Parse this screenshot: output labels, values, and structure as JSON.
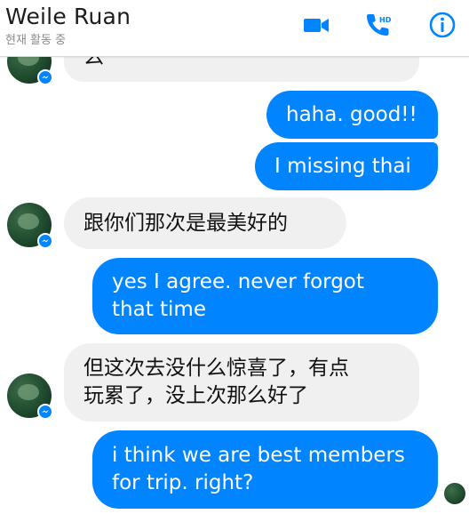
{
  "header": {
    "contact_name": "Weile Ruan",
    "status": "현재 활동 중",
    "icons": [
      "video-call-icon",
      "hd-voice-call-icon",
      "info-icon"
    ],
    "accent_color": "#0084ff"
  },
  "messages": [
    {
      "direction": "incoming",
      "text": "么"
    },
    {
      "direction": "outgoing",
      "text": "haha. good!!"
    },
    {
      "direction": "outgoing",
      "text": "I missing thai"
    },
    {
      "direction": "incoming",
      "text": "跟你们那次是最美好的"
    },
    {
      "direction": "outgoing",
      "lines": [
        "yes  I agree. never forgot",
        "that time"
      ]
    },
    {
      "direction": "incoming",
      "lines": [
        "但这次去没什么惊喜了，有点",
        "玩累了，没上次那么好了"
      ]
    },
    {
      "direction": "outgoing",
      "lines": [
        "i think we are best members",
        "for trip. right?"
      ]
    }
  ],
  "colors": {
    "incoming_bubble": "#f1f0f0",
    "outgoing_bubble": "#0084ff",
    "incoming_text": "#111111",
    "outgoing_text": "#ffffff"
  }
}
